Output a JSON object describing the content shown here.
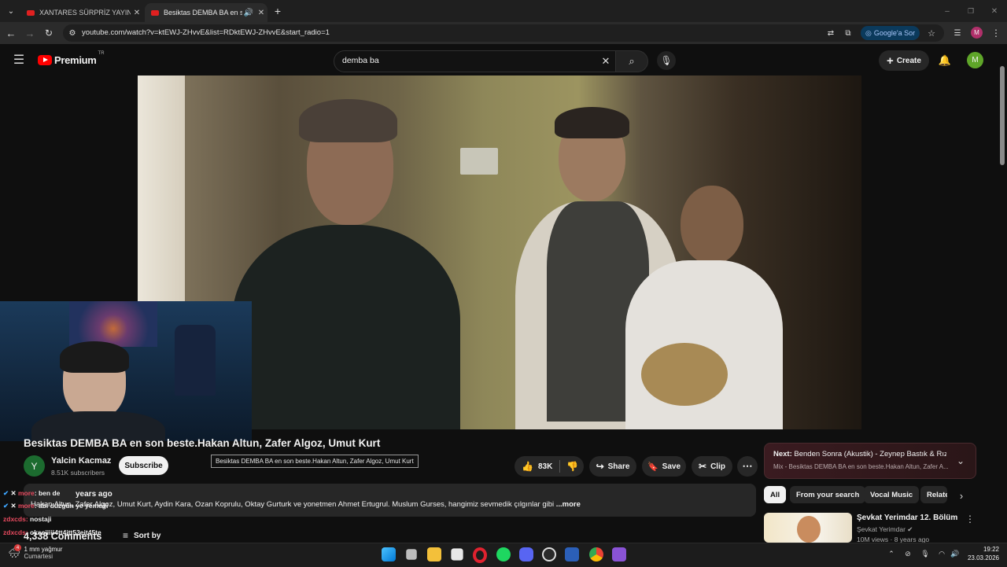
{
  "browser": {
    "tabs": [
      {
        "title": "XANTARES SÜRPRİZ YAYIN SON"
      },
      {
        "title": "Besiktas DEMBA BA en son"
      }
    ],
    "url": "youtube.com/watch?v=ktEWJ-ZHvvE&list=RDktEWJ-ZHvvE&start_radio=1",
    "google_button": "Google'a Sor",
    "profile_letter": "M"
  },
  "youtube": {
    "logo_text": "Premium",
    "region": "TR",
    "search_value": "demba ba",
    "create_label": "Create",
    "avatar_letter": "M"
  },
  "video": {
    "title": "Besiktas DEMBA BA en son beste.Hakan Altun, Zafer Algoz, Umut Kurt",
    "tooltip": "Besiktas DEMBA BA en son beste.Hakan Altun, Zafer Algoz, Umut Kurt",
    "channel_initial": "Y",
    "channel_name": "Yalcin Kacmaz",
    "subscribers": "8.51K subscribers",
    "subscribe_label": "Subscribe",
    "likes": "83K",
    "share_label": "Share",
    "save_label": "Save",
    "clip_label": "Clip",
    "upload_age": "years ago",
    "description": "Hakan Altun, Zafer Algoz, Umut Kurt, Aydin Kara, Ozan Koprulu, Oktay Gurturk ve yonetmen Ahmet Ertugrul. Muslum Gurses, hangimiz sevmedik çılgınlar gibi",
    "more_label": "...more",
    "comments_count": "4,338 Comments",
    "sort_label": "Sort by"
  },
  "sidebar": {
    "next_label": "Next:",
    "next_title": "Benden Sonra (Akustik) - Zeynep Bastık & Rız...",
    "next_subtitle": "Mix - Besiktas DEMBA BA en son beste.Hakan Altun, Zafer A...",
    "chips": [
      "All",
      "From your search",
      "Vocal Music",
      "Relate"
    ],
    "item_title": "Şevkat Yerimdar 12. Bölüm",
    "item_channel": "Şevkat Yerimdar",
    "item_meta": "10M views · 8 years ago"
  },
  "stream_chat": [
    {
      "nick": "more",
      "msg": "ben de"
    },
    {
      "nick": "more",
      "msg": "abi düzgün ye yemeği"
    },
    {
      "nick": "zdxcds:",
      "msg": "nostaji"
    },
    {
      "nick": "zdxcds:",
      "msg": "okseiiiii4tt4jtt53eit45te"
    }
  ],
  "taskbar": {
    "weather": "1 mm yağmur",
    "weather_sub": "Cumartesi",
    "time": "19:22",
    "date": "23.03.2026",
    "weather_badge": "4"
  },
  "colors": {
    "yt_red": "#ff0000",
    "bg": "#0f0f0f",
    "chip_active": "#f1f1f1",
    "avatar_green": "#5fa629"
  },
  "icons": [
    "menu-icon",
    "search-icon",
    "mic-icon",
    "bell-icon",
    "like-icon",
    "dislike-icon",
    "share-icon",
    "save-icon",
    "clip-icon",
    "more-icon",
    "chevron-down-icon",
    "sort-icon",
    "windows-icon"
  ]
}
